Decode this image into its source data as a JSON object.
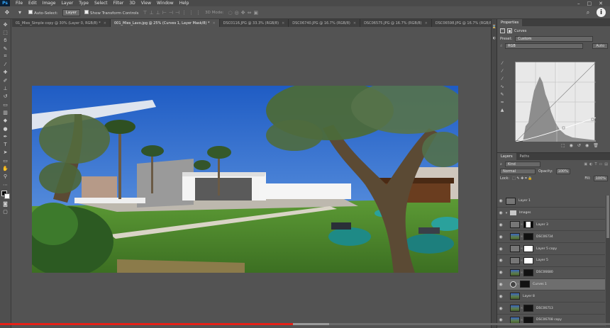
{
  "app": {
    "logo": "Ps",
    "menu": [
      "File",
      "Edit",
      "Image",
      "Layer",
      "Type",
      "Select",
      "Filter",
      "3D",
      "View",
      "Window",
      "Help"
    ],
    "window_controls": [
      "–",
      "□",
      "✕"
    ]
  },
  "options_bar": {
    "auto_select_label": "Auto-Select:",
    "auto_select_value": "Layer",
    "transform_label": "Show Transform Controls",
    "mode_label": "3D Mode:",
    "info_icon": "info-icon"
  },
  "tabs": [
    {
      "label": "01_Mies_Simple copy @ 30% (Layer 0, RGB/8) *",
      "active": false
    },
    {
      "label": "001_Mies_Lavo.jpg @ 25% (Curves 1, Layer Mask/8) *",
      "active": true
    },
    {
      "label": "DSC0116.JPG @ 33.3% (RGB/8)",
      "active": false
    },
    {
      "label": "DSC06740.JPG @ 16.7% (RGB/8)",
      "active": false
    },
    {
      "label": "DSC06575.JPG @ 16.7% (RGB/8)",
      "active": false
    },
    {
      "label": "DSC06598.JPG @ 16.7% (RGB/8)",
      "active": false
    }
  ],
  "properties": {
    "tabs": [
      "Properties"
    ],
    "adjustment_title": "Curves",
    "preset_label": "Preset:",
    "preset_value": "Custom",
    "channel_value": "RGB",
    "auto_label": "Auto"
  },
  "layers_panel": {
    "tabs": [
      "Layers",
      "Paths"
    ],
    "kind_value": "Kind",
    "blend_mode": "Normal",
    "opacity_label": "Opacity:",
    "opacity_value": "100%",
    "lock_label": "Lock:",
    "fill_label": "Fill:",
    "fill_value": "100%",
    "layers": [
      {
        "name": "Layer 1",
        "thumb": "line",
        "mask": "",
        "indent": false,
        "selected": false,
        "group": false
      },
      {
        "name": "Images",
        "thumb": "",
        "mask": "",
        "indent": false,
        "selected": false,
        "group": true
      },
      {
        "name": "Layer 3",
        "thumb": "line",
        "mask": "mixed",
        "indent": true,
        "selected": false,
        "group": false
      },
      {
        "name": "DSC06734",
        "thumb": "photo",
        "mask": "black",
        "indent": true,
        "selected": false,
        "group": false
      },
      {
        "name": "Layer 5 copy",
        "thumb": "line",
        "mask": "white",
        "indent": true,
        "selected": false,
        "group": false
      },
      {
        "name": "Layer 5",
        "thumb": "line",
        "mask": "white",
        "indent": true,
        "selected": false,
        "group": false
      },
      {
        "name": "DSC06680",
        "thumb": "photo",
        "mask": "black",
        "indent": true,
        "selected": false,
        "group": false
      },
      {
        "name": "Curves 1",
        "thumb": "adj",
        "mask": "black",
        "indent": true,
        "selected": true,
        "group": false
      },
      {
        "name": "Layer 8",
        "thumb": "photo",
        "mask": "",
        "indent": true,
        "selected": false,
        "group": false
      },
      {
        "name": "DSC06713",
        "thumb": "photo",
        "mask": "black",
        "indent": true,
        "selected": false,
        "group": false
      },
      {
        "name": "DSC06708 copy",
        "thumb": "photo",
        "mask": "black",
        "indent": true,
        "selected": false,
        "group": false
      },
      {
        "name": "DSC06708",
        "thumb": "photo",
        "mask": "black",
        "indent": true,
        "selected": false,
        "group": false
      }
    ]
  },
  "video": {
    "played_fraction": 0.48,
    "buffered_fraction": 0.52
  },
  "colors": {
    "accent_red": "#e62117",
    "sky_blue": "#2b66c9",
    "grass_green": "#4f8a2e"
  }
}
